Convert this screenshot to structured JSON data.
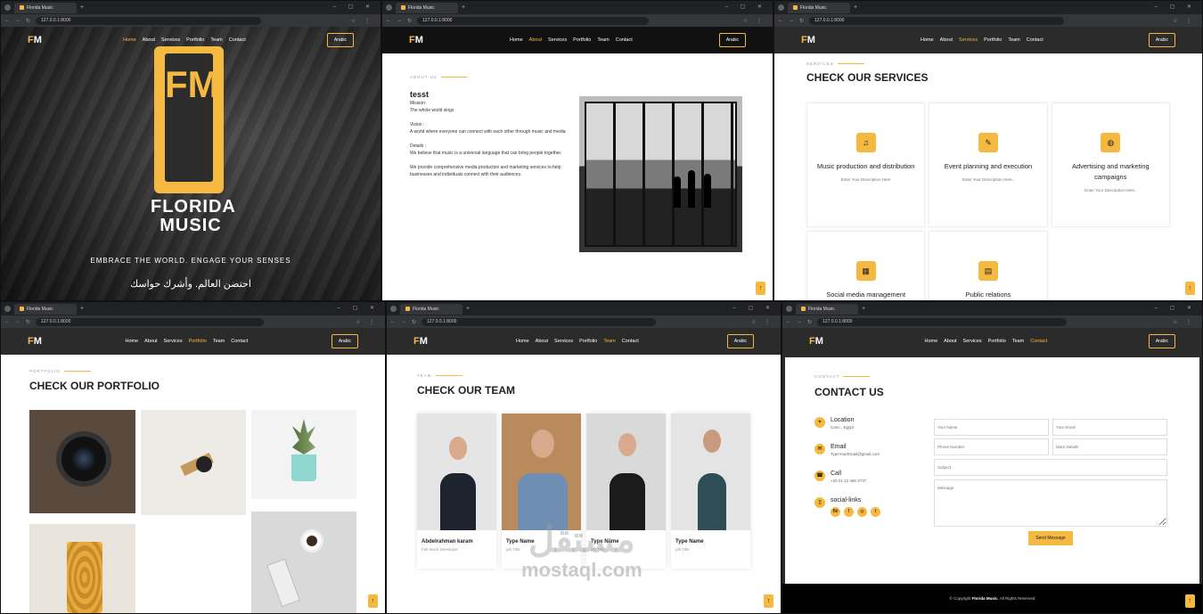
{
  "browser": {
    "tab_title": "Florida Music",
    "url": "127.0.0.1:8000"
  },
  "site": {
    "logo_f": "F",
    "logo_m": "M",
    "nav": [
      "Home",
      "About",
      "Services",
      "Portfolio",
      "Team",
      "Contact"
    ],
    "lang_button": "Arabic"
  },
  "hero": {
    "fm": "FM",
    "title_line1": "FLORIDA",
    "title_line2": "MUSIC",
    "tagline": "EMBRACE THE WORLD. ENGAGE YOUR SENSES",
    "arabic_tagline": "احتضن العالم. وأشرك حواسك"
  },
  "about": {
    "label": "ABOUT US",
    "title": "tesst",
    "mission_label": "Mission:",
    "mission": "The whole world sings",
    "vision_label": "Vision :",
    "vision": "A world where everyone can connect with each other through music and media",
    "details_label": "Details :",
    "details": "We believe that music is a universal language that can bring people together.",
    "extra": "We provide comprehensive media production and marketing services to help businesses and individuals connect with their audiences."
  },
  "services": {
    "label": "SERVICES",
    "title": "CHECK OUR SERVICES",
    "items": [
      {
        "title": "Music production and distribution",
        "desc": "Enter Your Description Here",
        "icon": "music-note-icon"
      },
      {
        "title": "Event planning and execution",
        "desc": "Enter Your Description Here..",
        "icon": "edit-icon"
      },
      {
        "title": "Advertising and marketing campaigns",
        "desc": "Enter Your Description Here..",
        "icon": "globe-icon"
      },
      {
        "title": "Social media management",
        "desc": "",
        "icon": "calendar-icon"
      },
      {
        "title": "Public relations",
        "desc": "",
        "icon": "document-icon"
      }
    ]
  },
  "portfolio": {
    "label": "PORTFOLIO",
    "title": "CHECK OUR PORTFOLIO"
  },
  "team": {
    "label": "TEAM",
    "title": "CHECK OUR TEAM",
    "members": [
      {
        "name": "Abdelrahman karam",
        "role": "Full-stack Developer"
      },
      {
        "name": "Type Name",
        "role": "job Title"
      },
      {
        "name": "Type Name",
        "role": "job Title"
      },
      {
        "name": "Type Name",
        "role": "job Title"
      }
    ]
  },
  "contact": {
    "label": "CONTACT",
    "title": "CONTACT US",
    "location_label": "Location",
    "location": "Cairo , Egypt",
    "email_label": "Email",
    "email": "TypeYourEmail@gmail.com",
    "call_label": "Call",
    "phone": "+20 01 12 486 3737",
    "social_label": "social-links",
    "placeholders": {
      "name": "Your Name",
      "email": "Your Email",
      "phone": "Phone Number",
      "more": "More Details",
      "subject": "Subject",
      "message": "Message"
    },
    "send": "Send Message",
    "footer_prefix": "© Copyright",
    "footer_brand": "Florida Music",
    "footer_suffix": ". All Rights Reserved"
  },
  "watermark": {
    "arabic": "مستقل",
    "latin": "mostaql.com"
  },
  "colors": {
    "accent": "#f5b942",
    "dark": "#2b2b2b"
  }
}
